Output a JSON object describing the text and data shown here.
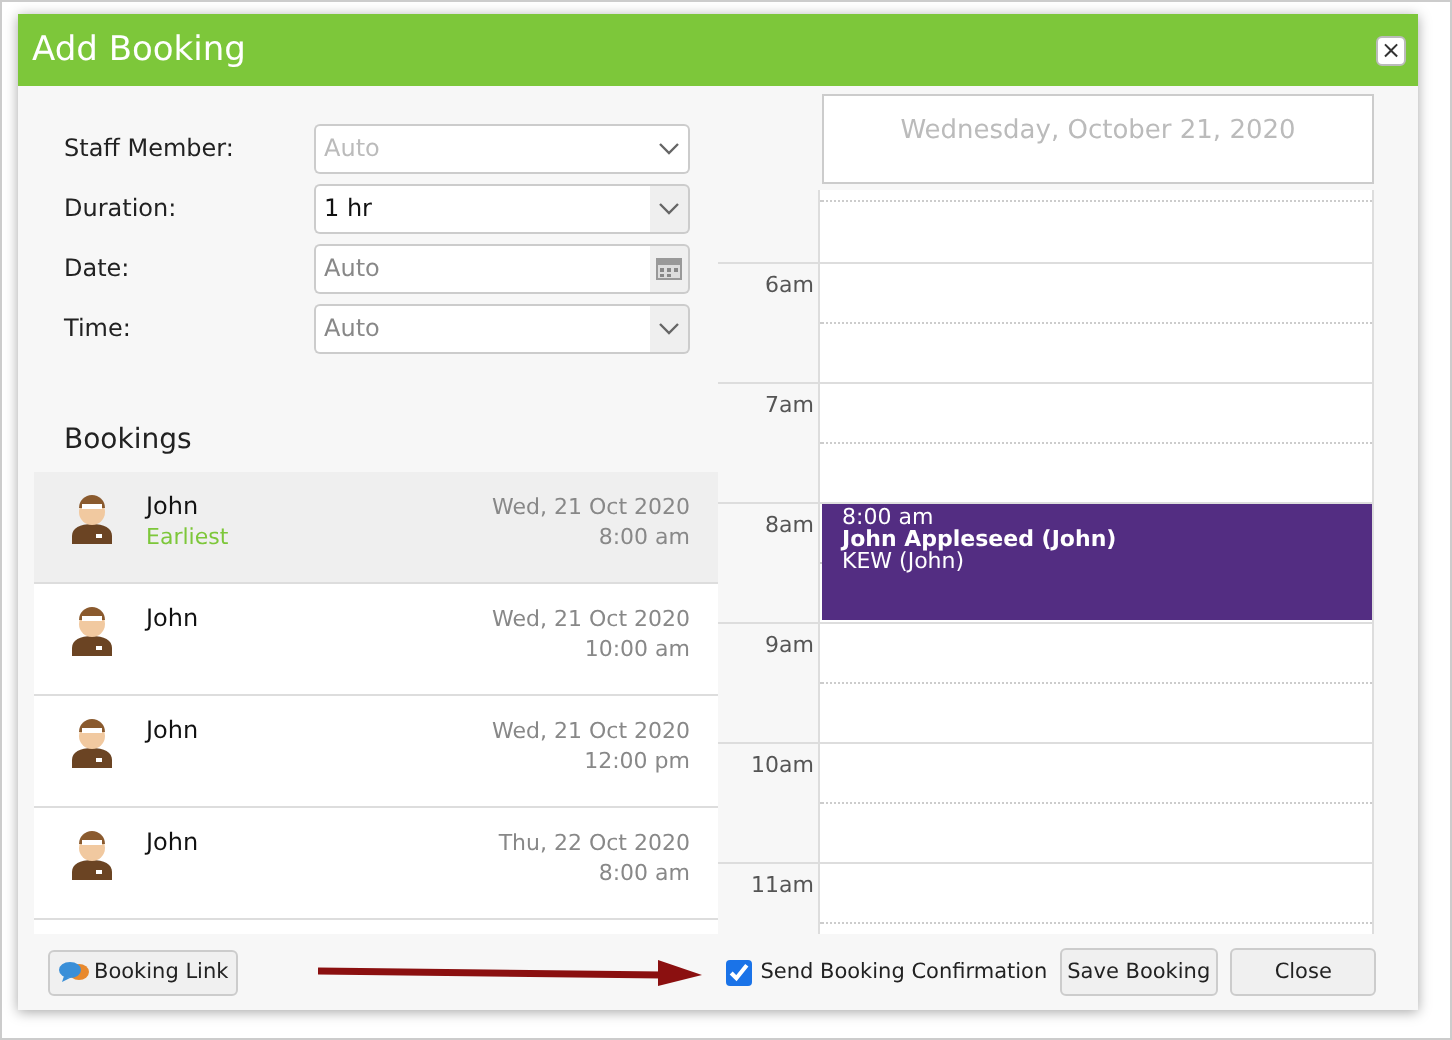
{
  "dialog": {
    "title": "Add Booking",
    "close_icon": "×"
  },
  "form": [
    {
      "label": "Staff Member:",
      "kind": "select",
      "placeholder": "Auto"
    },
    {
      "label": "Duration:",
      "kind": "select",
      "value": "1 hr"
    },
    {
      "label": "Date:",
      "kind": "date",
      "value": "Auto"
    },
    {
      "label": "Time:",
      "kind": "select",
      "value": "Auto"
    }
  ],
  "bookings_heading": "Bookings",
  "bookings": [
    {
      "name": "John",
      "note": "Earliest",
      "date": "Wed, 21 Oct 2020",
      "time": "8:00 am",
      "selected": true
    },
    {
      "name": "John",
      "date": "Wed, 21 Oct 2020",
      "time": "10:00 am",
      "selected": false
    },
    {
      "name": "John",
      "date": "Wed, 21 Oct 2020",
      "time": "12:00 pm",
      "selected": false
    },
    {
      "name": "John",
      "date": "Thu, 22 Oct 2020",
      "time": "8:00 am",
      "selected": false
    }
  ],
  "calendar": {
    "date_title": "Wednesday, October 21, 2020",
    "hours": [
      {
        "label": "6am"
      },
      {
        "label": "7am"
      },
      {
        "label": "8am",
        "event": {
          "time": "8:00 am",
          "title": "John Appleseed (John)",
          "location": "KEW (John)",
          "color": "#532d82"
        }
      },
      {
        "label": "9am"
      },
      {
        "label": "10am"
      },
      {
        "label": "11am"
      }
    ]
  },
  "footer": {
    "booking_link": "Booking Link",
    "send_confirmation": {
      "label": "Send Booking Confirmation",
      "checked": true
    },
    "buttons": [
      "Save Booking",
      "Close"
    ]
  }
}
